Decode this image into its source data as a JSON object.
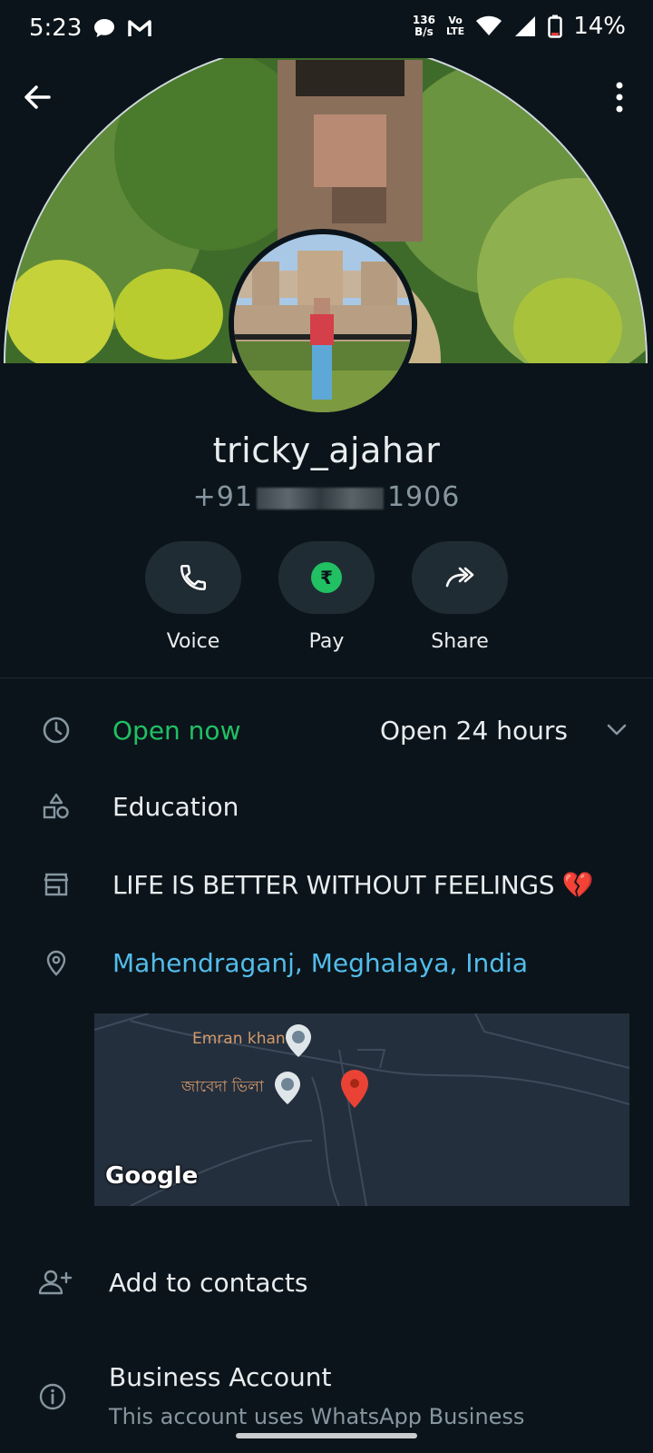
{
  "status_bar": {
    "time": "5:23",
    "net_speed_value": "136",
    "net_speed_unit": "B/s",
    "volte_top": "Vo",
    "volte_bottom": "LTE",
    "battery": "14%"
  },
  "profile": {
    "name": "tricky_ajahar",
    "phone_prefix": "+91",
    "phone_suffix": "1906"
  },
  "actions": {
    "voice": "Voice",
    "pay": "Pay",
    "share": "Share",
    "pay_symbol": "₹"
  },
  "business_hours": {
    "status": "Open now",
    "hours": "Open 24 hours"
  },
  "category": "Education",
  "description": "LIFE IS BETTER WITHOUT FEELINGS 💔",
  "address": "Mahendraganj, Meghalaya, India",
  "map": {
    "place1": "Emran khan",
    "place2": "জাবেদা ভিলা",
    "provider": "Google"
  },
  "add_contacts": "Add to contacts",
  "business_account": {
    "title": "Business Account",
    "subtitle": "This account uses WhatsApp Business"
  },
  "colors": {
    "background": "#0b141a",
    "open_green": "#21c063",
    "link_blue": "#53bdeb",
    "pill_bg": "#202c33"
  }
}
